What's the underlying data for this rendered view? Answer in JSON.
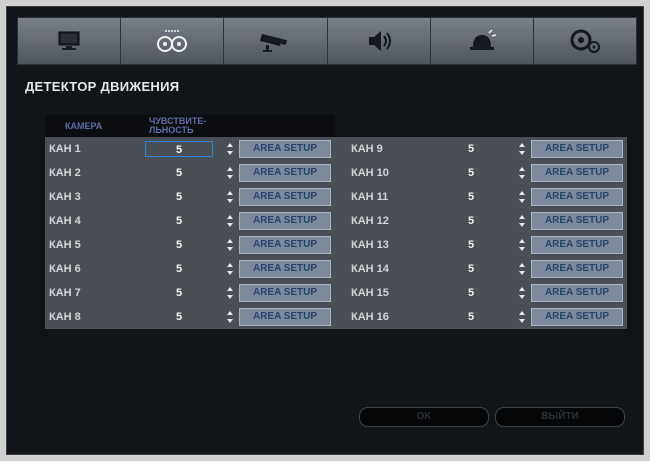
{
  "tabs": [
    {
      "name": "display-icon"
    },
    {
      "name": "recording-icon"
    },
    {
      "name": "camera-icon"
    },
    {
      "name": "speaker-icon"
    },
    {
      "name": "alarm-icon"
    },
    {
      "name": "system-icon"
    }
  ],
  "page_title": "ДЕТЕКТОР ДВИЖЕНИЯ",
  "columns": {
    "camera": "КАМЕРА",
    "sensitivity_line1": "ЧУВСТВИТЕ-",
    "sensitivity_line2": "ЛЬНОСТЬ"
  },
  "channels_left": [
    {
      "name": "КАН 1",
      "value": "5",
      "button": "AREA SETUP"
    },
    {
      "name": "КАН 2",
      "value": "5",
      "button": "AREA SETUP"
    },
    {
      "name": "КАН 3",
      "value": "5",
      "button": "AREA SETUP"
    },
    {
      "name": "КАН 4",
      "value": "5",
      "button": "AREA SETUP"
    },
    {
      "name": "КАН 5",
      "value": "5",
      "button": "AREA SETUP"
    },
    {
      "name": "КАН 6",
      "value": "5",
      "button": "AREA SETUP"
    },
    {
      "name": "КАН 7",
      "value": "5",
      "button": "AREA SETUP"
    },
    {
      "name": "КАН 8",
      "value": "5",
      "button": "AREA SETUP"
    }
  ],
  "channels_right": [
    {
      "name": "КАН 9",
      "value": "5",
      "button": "AREA SETUP"
    },
    {
      "name": "КАН 10",
      "value": "5",
      "button": "AREA SETUP"
    },
    {
      "name": "КАН 11",
      "value": "5",
      "button": "AREA SETUP"
    },
    {
      "name": "КАН 12",
      "value": "5",
      "button": "AREA SETUP"
    },
    {
      "name": "КАН 13",
      "value": "5",
      "button": "AREA SETUP"
    },
    {
      "name": "КАН 14",
      "value": "5",
      "button": "AREA SETUP"
    },
    {
      "name": "КАН 15",
      "value": "5",
      "button": "AREA SETUP"
    },
    {
      "name": "КАН 16",
      "value": "5",
      "button": "AREA SETUP"
    }
  ],
  "buttons": {
    "ok": "OK",
    "exit": "ВЫЙТИ"
  }
}
